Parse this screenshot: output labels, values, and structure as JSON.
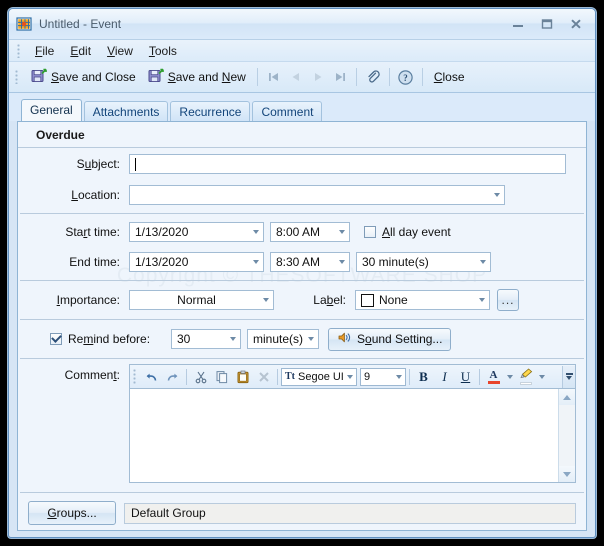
{
  "window": {
    "title": "Untitled - Event",
    "icon": "calendar-grid-icon",
    "minimize": "–",
    "maximize": "❑",
    "close": "✕"
  },
  "menu": {
    "items": [
      {
        "label": "File",
        "accel": "F"
      },
      {
        "label": "Edit",
        "accel": "E"
      },
      {
        "label": "View",
        "accel": "V"
      },
      {
        "label": "Tools",
        "accel": "T"
      }
    ]
  },
  "toolbar": {
    "save_and_close": "Save and Close",
    "save_and_new": "Save and New",
    "nav_first": "first-record",
    "nav_prev": "previous-record",
    "nav_next": "next-record",
    "nav_last": "last-record",
    "attach": "attachment",
    "help": "help",
    "close": "Close"
  },
  "tabs": [
    {
      "label": "General",
      "active": true
    },
    {
      "label": "Attachments",
      "active": false
    },
    {
      "label": "Recurrence",
      "active": false
    },
    {
      "label": "Comment",
      "active": false
    }
  ],
  "status": {
    "overdue": "Overdue"
  },
  "watermark": "Copyright © THESOFTWARE SHOP",
  "form": {
    "subject_label": "Subject:",
    "subject_value": "",
    "location_label": "Location:",
    "location_value": "",
    "start_label": "Start time:",
    "start_date": "1/13/2020",
    "start_time": "8:00 AM",
    "all_day_label": "All day event",
    "all_day_checked": false,
    "end_label": "End time:",
    "end_date": "1/13/2020",
    "end_time": "8:30 AM",
    "duration": "30 minute(s)",
    "importance_label": "Importance:",
    "importance_value": "Normal",
    "label_label": "Label:",
    "label_value": "None",
    "label_color": "#ffffff",
    "label_more": "...",
    "remind_label": "Remind before:",
    "remind_checked": true,
    "remind_amount": "30",
    "remind_unit": "minute(s)",
    "sound_setting": "Sound Setting...",
    "comment_label": "Comment:",
    "comment_value": ""
  },
  "rtf": {
    "undo": "undo-icon",
    "redo": "redo-icon",
    "cut": "cut-icon",
    "copy": "copy-icon",
    "paste": "paste-icon",
    "delete": "delete-icon",
    "font_name": "Segoe UI",
    "font_size": "9",
    "bold": "B",
    "italic": "I",
    "underline": "U",
    "font_color": "A",
    "highlight": "highlighter-icon",
    "overflow": "»"
  },
  "footer": {
    "groups_button": "Groups...",
    "group_value": "Default Group"
  },
  "colors": {
    "frame": "#5f8fc0",
    "panel_bg": "#eff5fc",
    "accent_blue": "#12447a",
    "font_color_bar": "#e8452c",
    "highlight_bar": "#ffffff"
  }
}
